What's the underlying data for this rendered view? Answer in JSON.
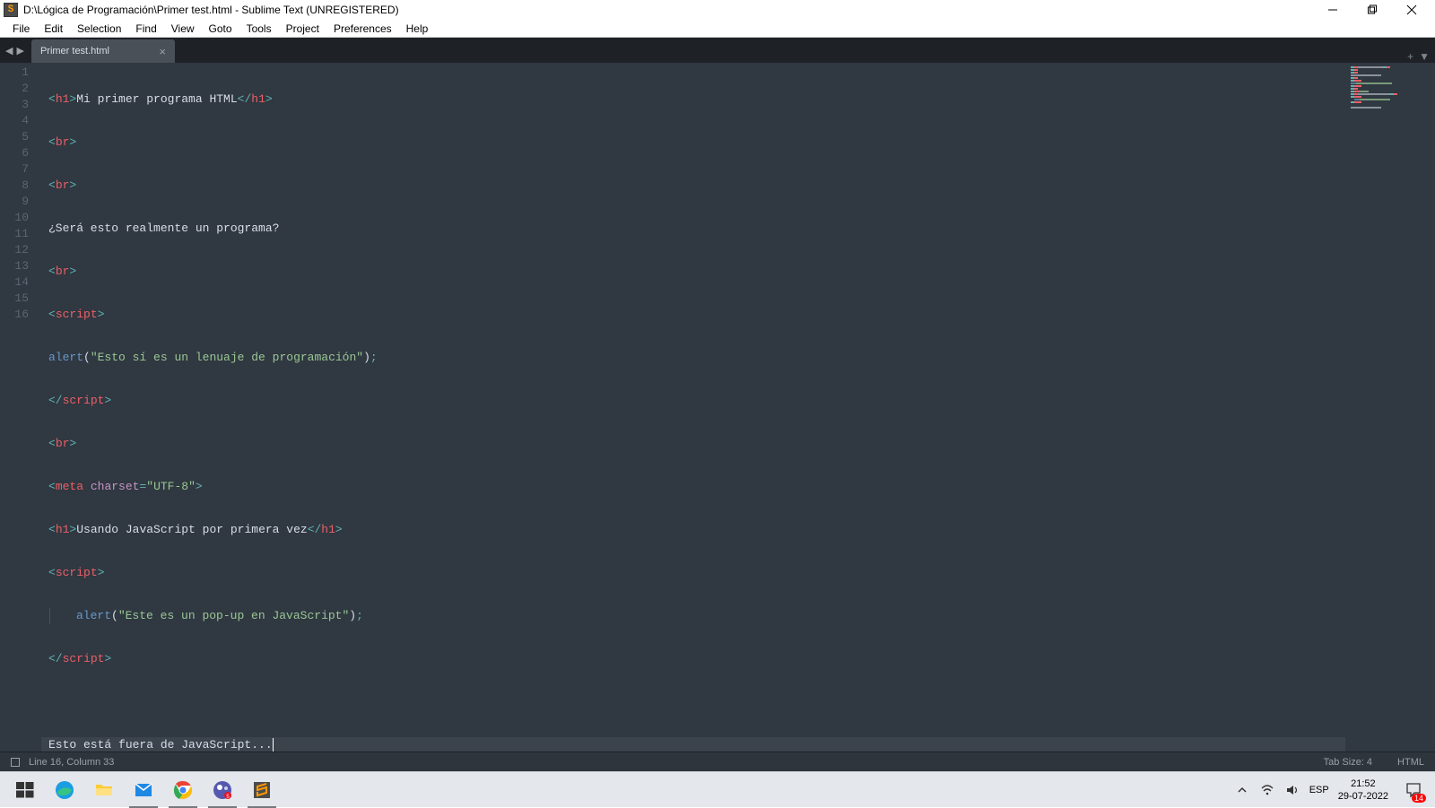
{
  "titlebar": {
    "title": "D:\\Lógica de Programación\\Primer test.html - Sublime Text (UNREGISTERED)"
  },
  "menubar": {
    "items": [
      "File",
      "Edit",
      "Selection",
      "Find",
      "View",
      "Goto",
      "Tools",
      "Project",
      "Preferences",
      "Help"
    ]
  },
  "tabs": {
    "tab0": {
      "label": "Primer test.html"
    }
  },
  "gutter": [
    "1",
    "2",
    "3",
    "4",
    "5",
    "6",
    "7",
    "8",
    "9",
    "10",
    "11",
    "12",
    "13",
    "14",
    "15",
    "16"
  ],
  "code": {
    "l1": {
      "a": "<",
      "b": "h1",
      "c": ">",
      "d": "Mi primer programa HTML",
      "e": "</",
      "f": "h1",
      "g": ">"
    },
    "l2": {
      "a": "<",
      "b": "br",
      "c": ">"
    },
    "l3": {
      "a": "<",
      "b": "br",
      "c": ">"
    },
    "l4": {
      "a": "¿Será esto realmente un programa?"
    },
    "l5": {
      "a": "<",
      "b": "br",
      "c": ">"
    },
    "l6": {
      "a": "<",
      "b": "script",
      "c": ">"
    },
    "l7": {
      "a": "alert",
      "b": "(",
      "c": "\"Esto sí es un lenuaje de programación\"",
      "d": ")",
      "e": ";"
    },
    "l8": {
      "a": "</",
      "b": "script",
      "c": ">"
    },
    "l9": {
      "a": "<",
      "b": "br",
      "c": ">"
    },
    "l10": {
      "a": "<",
      "b": "meta",
      "c": " ",
      "d": "charset",
      "e": "=",
      "f": "\"UTF-8\"",
      "g": ">"
    },
    "l11": {
      "a": "<",
      "b": "h1",
      "c": ">",
      "d": "Usando JavaScript por primera vez",
      "e": "</",
      "f": "h1",
      "g": ">"
    },
    "l12": {
      "a": "<",
      "b": "script",
      "c": ">"
    },
    "l13": {
      "a": "alert",
      "b": "(",
      "c": "\"Este es un pop-up en JavaScript\"",
      "d": ")",
      "e": ";"
    },
    "l14": {
      "a": "</",
      "b": "script",
      "c": ">"
    },
    "l15": {
      "a": ""
    },
    "l16": {
      "a": "Esto está fuera de JavaScript..."
    }
  },
  "statusbar": {
    "linecol": "Line 16, Column 33",
    "tabsize": "Tab Size: 4",
    "syntax": "HTML"
  },
  "taskbar": {
    "lang": "ESP",
    "time": "21:52",
    "date": "29-07-2022",
    "notif_count": "14"
  }
}
